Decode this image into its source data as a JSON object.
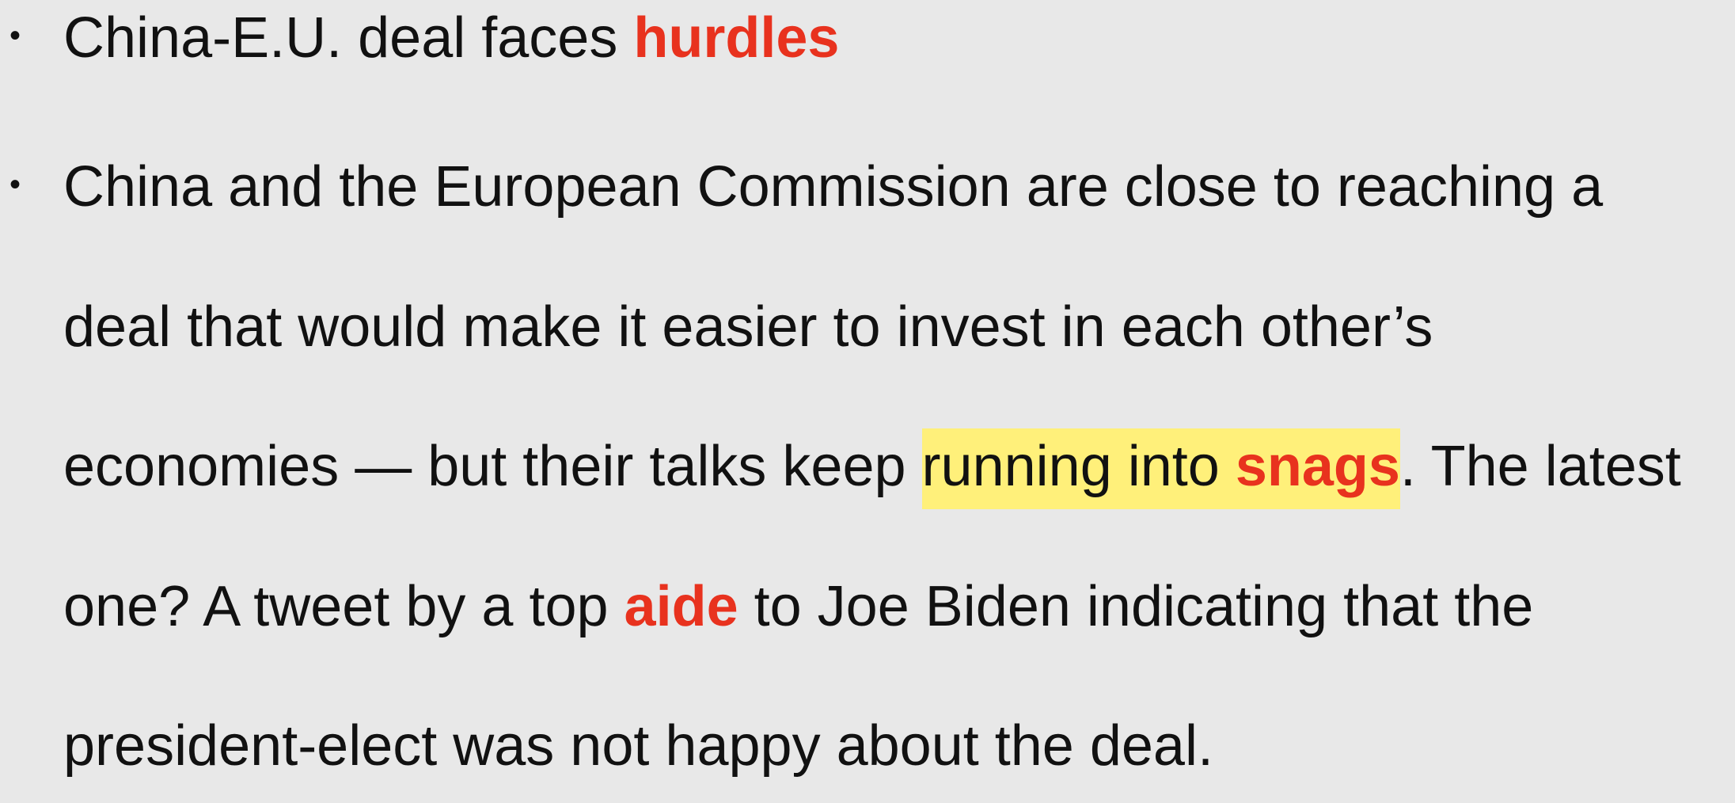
{
  "bullets": [
    {
      "symbol": "•",
      "lines": [
        {
          "before": "China-E.U. deal faces ",
          "red": "hurdles"
        }
      ]
    },
    {
      "symbol": "•",
      "lines": [
        {
          "text": "China and the European Commission are close to reaching a"
        },
        {
          "text": "deal that would make it easier to invest in each other’s"
        },
        {
          "before": "economies — but their talks keep ",
          "highlight_plain": "running into ",
          "highlight_red": "snags",
          "after": ". The latest"
        },
        {
          "before": "one? A tweet by a top ",
          "red": "aide",
          "after": " to Joe Biden indicating that the"
        },
        {
          "text": "president-elect was not happy about the deal."
        }
      ]
    }
  ],
  "colors": {
    "background": "#e8e8e8",
    "text": "#111111",
    "emphasis_red": "#e8321e",
    "highlight_yellow": "#fff07a"
  }
}
